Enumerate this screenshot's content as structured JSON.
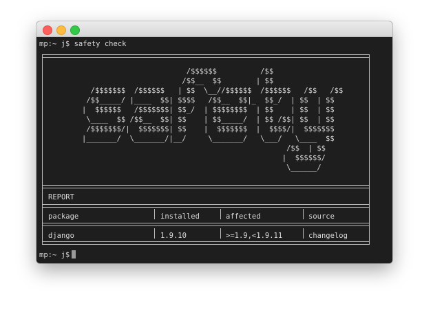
{
  "terminal": {
    "prompt_line": "mp:~ j$ safety check",
    "final_prompt": "mp:~ j$"
  },
  "banner": {
    "ascii_art": "                        /$$$$$$          /$$\n                       /$$__  $$        | $$\n  /$$$$$$$  /$$$$$$   | $$  \\__//$$$$$$  /$$$$$$   /$$   /$$\n /$$_____/ |____  $$| $$$$   /$$__  $$|_  $$_/  | $$  | $$\n|  $$$$$$   /$$$$$$$| $$_/  | $$$$$$$$  | $$    | $$  | $$\n \\____  $$ /$$__  $$| $$    | $$_____/  | $$ /$$| $$  | $$\n /$$$$$$$/|  $$$$$$$| $$    |  $$$$$$$  |  $$$$/|  $$$$$$$\n|_______/  \\_______/|__/     \\_______/   \\___/   \\____  $$\n                                               /$$  | $$\n                                              |  $$$$$$/\n                                               \\______/"
  },
  "report": {
    "title": "REPORT",
    "columns": [
      "package",
      "installed",
      "affected",
      "source"
    ],
    "rows": [
      [
        "django",
        "1.9.10",
        ">=1.9,<1.9.11",
        "changelog"
      ]
    ]
  },
  "colors": {
    "terminal_bg": "#1e1e1e",
    "terminal_fg": "#d9d9d9",
    "close": "#fc605c",
    "minimize": "#fdbc40",
    "maximize": "#34c84a"
  }
}
